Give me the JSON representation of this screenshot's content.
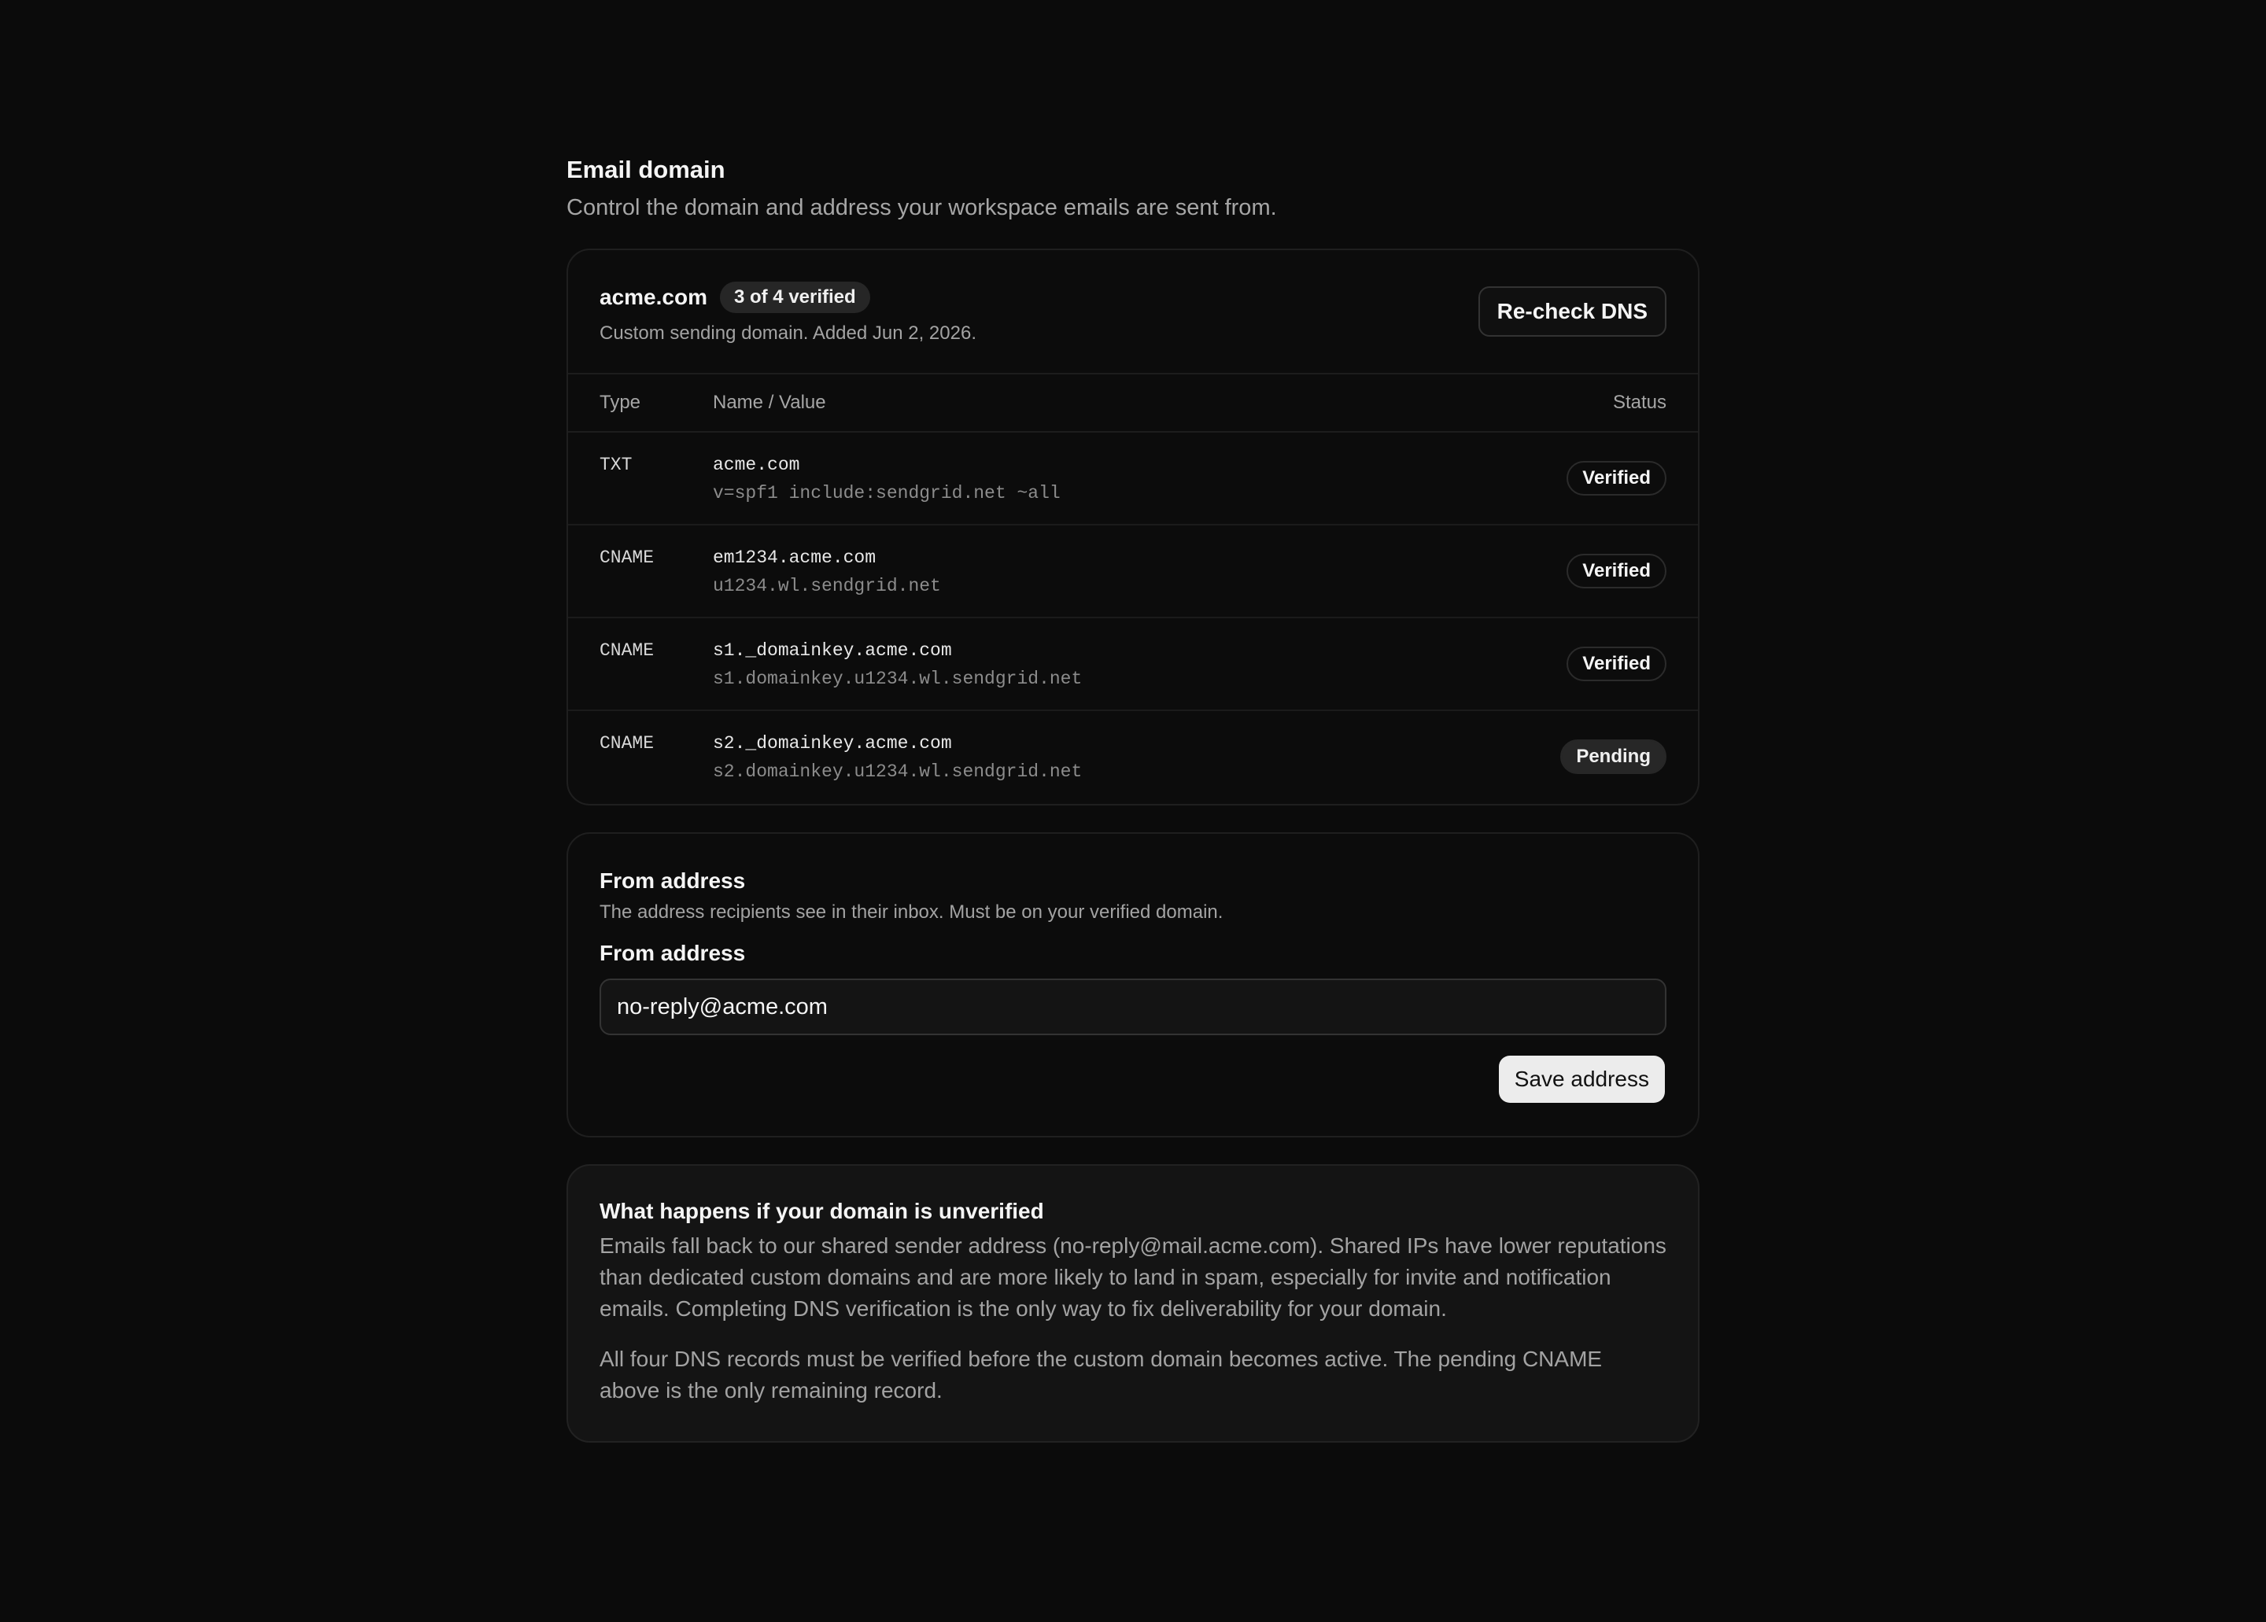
{
  "header": {
    "title": "Email domain",
    "subtitle": "Control the domain and address your workspace emails are sent from."
  },
  "domain": {
    "name": "acme.com",
    "verified_badge": "3 of 4 verified",
    "meta": "Custom sending domain. Added Jun 2, 2026.",
    "recheck_label": "Re-check DNS",
    "columns": {
      "type": "Type",
      "name_value": "Name / Value",
      "status": "Status"
    },
    "records": [
      {
        "type": "TXT",
        "name": "acme.com",
        "value": "v=spf1 include:sendgrid.net ~all",
        "status": "Verified"
      },
      {
        "type": "CNAME",
        "name": "em1234.acme.com",
        "value": "u1234.wl.sendgrid.net",
        "status": "Verified"
      },
      {
        "type": "CNAME",
        "name": "s1._domainkey.acme.com",
        "value": "s1.domainkey.u1234.wl.sendgrid.net",
        "status": "Verified"
      },
      {
        "type": "CNAME",
        "name": "s2._domainkey.acme.com",
        "value": "s2.domainkey.u1234.wl.sendgrid.net",
        "status": "Pending"
      }
    ]
  },
  "from_address": {
    "title": "From address",
    "description": "The address recipients see in their inbox. Must be on your verified domain.",
    "field_label": "From address",
    "value": "no-reply@acme.com",
    "save_label": "Save address"
  },
  "info": {
    "title": "What happens if your domain is unverified",
    "paragraphs": [
      "Emails fall back to our shared sender address (no-reply@mail.acme.com). Shared IPs have lower reputations than dedicated custom domains and are more likely to land in spam, especially for invite and notification emails. Completing DNS verification is the only way to fix deliverability for your domain.",
      "All four DNS records must be verified before the custom domain becomes active. The pending CNAME above is the only remaining record."
    ]
  }
}
